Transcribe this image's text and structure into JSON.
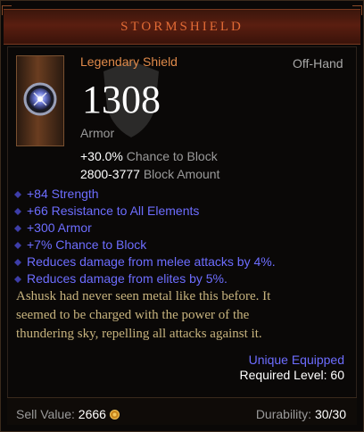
{
  "item": {
    "name": "STORMSHIELD",
    "type": "Legendary Shield",
    "slot": "Off-Hand",
    "armor_value": "1308",
    "armor_label": "Armor",
    "block_chance": "+30.0%",
    "block_chance_label": "Chance to Block",
    "block_amount": "2800-3777",
    "block_amount_label": "Block Amount"
  },
  "affixes": [
    "+84 Strength",
    "+66 Resistance to All Elements",
    "+300 Armor",
    "+7% Chance to Block",
    "Reduces damage from melee attacks by 4%.",
    "Reduces damage from elites by 5%."
  ],
  "flavor": {
    "line1": "Ashusk had never seen metal like this before. It",
    "line2": "seemed to be charged with the power of the",
    "line3": "thundering sky, repelling all attacks against it."
  },
  "footer": {
    "unique_equipped": "Unique Equipped",
    "required_level_label": "Required Level:",
    "required_level": "60",
    "sell_label": "Sell Value:",
    "sell_value": "2666",
    "durability_label": "Durability:",
    "durability_value": "30/30"
  },
  "colors": {
    "title": "#e06a35",
    "legendary": "#e08a4a",
    "magic_affix": "#6d6dff",
    "flavor": "#c7b37e"
  },
  "icons": [
    "shield-icon",
    "gold-coin-icon",
    "affix-bullet-icon"
  ]
}
